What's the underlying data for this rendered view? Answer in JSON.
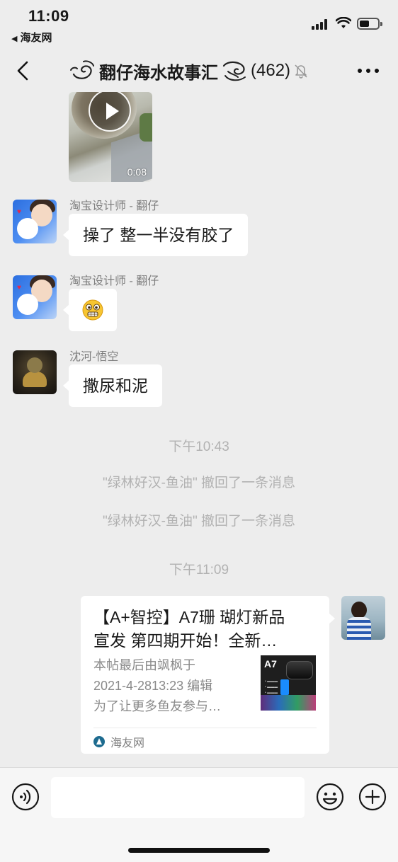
{
  "status_bar": {
    "time": "11:09",
    "back_app_label": "海友网"
  },
  "nav": {
    "group_name": "翻仔海水故事汇",
    "member_count": "(462)"
  },
  "messages": {
    "video": {
      "duration": "0:08"
    },
    "msg1": {
      "sender": "淘宝设计师 - 翻仔",
      "text": "操了 整一半没有胶了"
    },
    "msg2": {
      "sender": "淘宝设计师 - 翻仔",
      "emoji": "grimace-emoji"
    },
    "msg3": {
      "sender": "沈河-悟空",
      "text": "撒尿和泥"
    },
    "timestamp1": "下午10:43",
    "recall1": "\"绿林好汉-鱼油\" 撤回了一条消息",
    "recall2": "\"绿林好汉-鱼油\" 撤回了一条消息",
    "timestamp2": "下午11:09"
  },
  "link_card": {
    "title_line1": "【A+智控】A7珊 瑚灯新品",
    "title_line2": "宣发 第四期开始！全新…",
    "desc_line1": "本帖最后由飒枫于",
    "desc_line2": "2021-4-2813:23 编辑",
    "desc_line3": "为了让更多鱼友参与…",
    "thumb_label": "A7",
    "source": "海友网"
  },
  "input_bar": {
    "text_value": ""
  },
  "colors": {
    "background": "#ededed",
    "bubble": "#ffffff",
    "system_text": "#b2b2b2",
    "sender_name": "#7f7f7f"
  }
}
